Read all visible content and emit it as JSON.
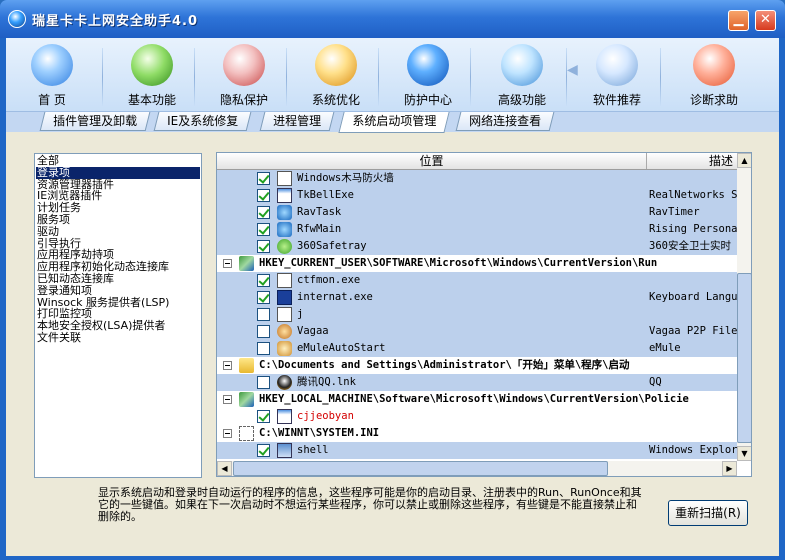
{
  "window": {
    "title": "瑞星卡卡上网安全助手4.0"
  },
  "toolbar": [
    {
      "label": "首 页",
      "icon": "home-icon"
    },
    {
      "label": "基本功能",
      "icon": "mouse-icon"
    },
    {
      "label": "隐私保护",
      "icon": "shield-icon"
    },
    {
      "label": "系统优化",
      "icon": "monitor-gear-icon"
    },
    {
      "label": "防护中心",
      "icon": "globe-icon"
    },
    {
      "label": "高级功能",
      "icon": "cubes-icon"
    },
    {
      "label": "软件推荐",
      "icon": "window-icon"
    },
    {
      "label": "诊断求助",
      "icon": "heart-hands-icon"
    }
  ],
  "tabs": [
    "插件管理及卸载",
    "IE及系统修复",
    "进程管理",
    "系统启动项管理",
    "网络连接查看"
  ],
  "active_tab": "系统启动项管理",
  "left_list": {
    "items": [
      "全部",
      "登录项",
      "资源管理器插件",
      "IE浏览器插件",
      "计划任务",
      "服务项",
      "驱动",
      "引导执行",
      "应用程序劫持项",
      "应用程序初始化动态连接库",
      "已知动态连接库",
      "登录通知项",
      "Winsock 服务提供者(LSP)",
      "打印监控项",
      "本地安全授权(LSA)提供者",
      "文件关联"
    ],
    "selected": "登录项"
  },
  "grid": {
    "col_location": "位置",
    "col_desc": "描述",
    "rows": [
      {
        "type": "item",
        "checked": true,
        "icon": "text-icon",
        "name": "Windows木马防火墙",
        "desc": ""
      },
      {
        "type": "item",
        "checked": true,
        "icon": "app-icon",
        "name": "TkBellExe",
        "desc": "RealNetworks S"
      },
      {
        "type": "item",
        "checked": true,
        "icon": "rav-icon",
        "name": "RavTask",
        "desc": "RavTimer"
      },
      {
        "type": "item",
        "checked": true,
        "icon": "rav-icon",
        "name": "RfwMain",
        "desc": "Rising Persona"
      },
      {
        "type": "item",
        "checked": true,
        "icon": "360-icon",
        "name": "360Safetray",
        "desc": "360安全卫士实时"
      },
      {
        "type": "group",
        "icon": "registry-icon",
        "name": "HKEY_CURRENT_USER\\SOFTWARE\\Microsoft\\Windows\\CurrentVersion\\Run"
      },
      {
        "type": "item",
        "checked": true,
        "icon": "text-icon",
        "name": "ctfmon.exe",
        "desc": ""
      },
      {
        "type": "item",
        "checked": true,
        "icon": "help-icon",
        "name": "internat.exe",
        "desc": "Keyboard Langu"
      },
      {
        "type": "item",
        "checked": false,
        "icon": "text-icon",
        "name": "j",
        "desc": ""
      },
      {
        "type": "item",
        "checked": false,
        "icon": "vagaa-icon",
        "name": "Vagaa",
        "desc": "Vagaa P2P File"
      },
      {
        "type": "item",
        "checked": false,
        "icon": "emule-icon",
        "name": "eMuleAutoStart",
        "desc": "eMule"
      },
      {
        "type": "group",
        "icon": "folder-icon",
        "name": "C:\\Documents and Settings\\Administrator\\「开始」菜单\\程序\\启动"
      },
      {
        "type": "item",
        "checked": false,
        "icon": "qq-icon",
        "name": "腾讯QQ.lnk",
        "desc": "QQ"
      },
      {
        "type": "group",
        "icon": "registry-icon",
        "name": "HKEY_LOCAL_MACHINE\\Software\\Microsoft\\Windows\\CurrentVersion\\Policie"
      },
      {
        "type": "sel",
        "checked": true,
        "icon": "app-icon",
        "name": "cjjeobyan",
        "desc": "",
        "color": "#d40000"
      },
      {
        "type": "group",
        "icon": "ini-icon",
        "name": "C:\\WINNT\\SYSTEM.INI"
      },
      {
        "type": "item",
        "checked": true,
        "icon": "shell-icon",
        "name": "shell",
        "desc": "Windows Explor"
      }
    ]
  },
  "description": "显示系统启动和登录时自动运行的程序的信息，这些程序可能是你的启动目录、注册表中的Run、RunOnce和其它的一些键值。如果在下一次启动时不想运行某些程序，你可以禁止或删除这些程序，有些键是不能直接禁止和删除的。",
  "rescan_button": "重新扫描(R)",
  "colors": {
    "title_bar": "#2e74d8",
    "selection": "#0a246a",
    "row_highlight": "#bcd0ec",
    "alert_text": "#d40000"
  }
}
